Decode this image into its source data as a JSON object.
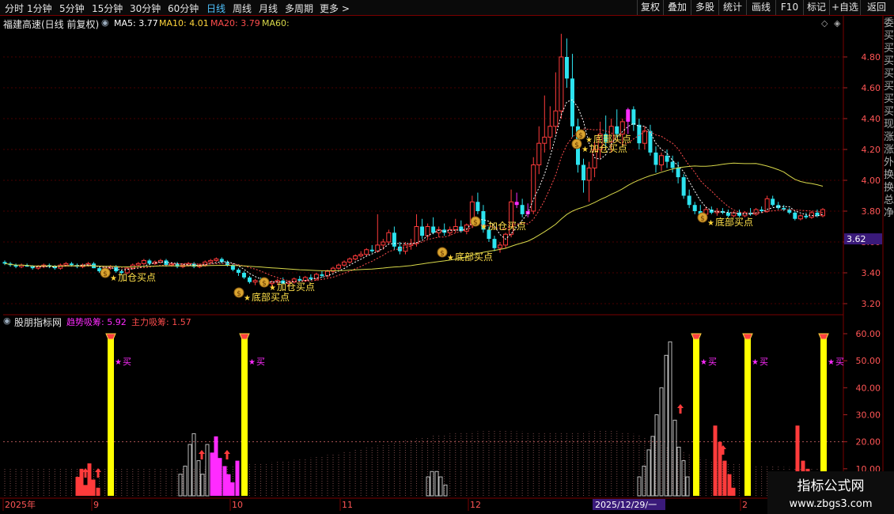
{
  "toolbar": {
    "timeframes": [
      "分时",
      "1分钟",
      "5分钟",
      "15分钟",
      "30分钟",
      "60分钟",
      "日线",
      "周线",
      "月线",
      "多周期",
      "更多 >"
    ],
    "active": "日线",
    "buttons": [
      "复权",
      "叠加",
      "多股",
      "统计",
      "画线",
      "F10",
      "标记",
      "+自选",
      "返回"
    ]
  },
  "main": {
    "title": "福建高速(日线 前复权)",
    "ma5_label": "MA5: 3.77",
    "ma10_label": "MA10: 4.01",
    "ma20_label": "MA20: 3.79",
    "ma60_label": "MA60:",
    "price_ticks": [
      "4.80",
      "4.60",
      "4.40",
      "4.20",
      "4.00",
      "3.80",
      "3.60",
      "3.40",
      "3.20"
    ],
    "current_price": "3.62",
    "annotations": [
      "加仓买点",
      "底部买点",
      "底部买点",
      "加仓买点",
      "加仓买点",
      "底部买点",
      "加仓买点",
      "底部买点",
      "底部买点"
    ]
  },
  "indicator": {
    "name": "股朋指标网",
    "trend_label": "趋势吸筹: 5.92",
    "main_label": "主力吸筹: 1.57",
    "ticks": [
      "60.00",
      "50.00",
      "40.00",
      "30.00",
      "20.00",
      "10.00"
    ],
    "buy_label": "买"
  },
  "dates": {
    "labels": [
      "2025年",
      "9",
      "10",
      "11",
      "12",
      "2"
    ],
    "cursor_date": "2025/12/29/一"
  },
  "side_text": "委买买买买买买买现涨涨外换换总净",
  "watermark": {
    "line1": "指标公式网",
    "line2": "www.zbgs3.com"
  },
  "colors": {
    "up": "#ff3b3b",
    "down": "#2de3ef",
    "ma5": "#ffffff",
    "ma10": "#ffd43b",
    "ma20": "#ff4d4d",
    "ma60": "#d8d84a",
    "magenta": "#ff2bff",
    "yellow": "#ffff00"
  }
}
